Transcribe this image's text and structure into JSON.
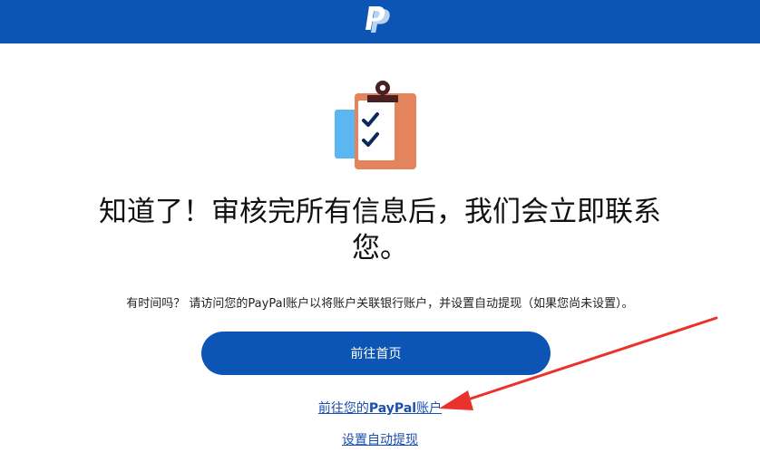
{
  "header": {
    "brand_color": "#0d55b5",
    "logo_icon": "paypal-logo-icon"
  },
  "illustration": {
    "icon": "clipboard-checklist-icon",
    "colors": {
      "clipboard": "#e4845c",
      "paper": "#ffffff",
      "back_card": "#5bb6f2",
      "clip": "#4a1f24",
      "check": "#0b2a5c"
    }
  },
  "main": {
    "headline_line1": "知道了！审核完所有信息后，我们会立即联系",
    "headline_line2": "您。",
    "subtext": "有时间吗？ 请访问您的PayPal账户以将账户关联银行账户，并设置自动提现（如果您尚未设置）。",
    "primary_button_label": "前往首页",
    "account_link_prefix": "前往您的",
    "account_link_brand": "PayPal",
    "account_link_suffix": "账户",
    "withdraw_link_label": "设置自动提现"
  },
  "annotation": {
    "arrow_color": "#e8322b",
    "arrow_icon": "red-arrow-annotation"
  }
}
